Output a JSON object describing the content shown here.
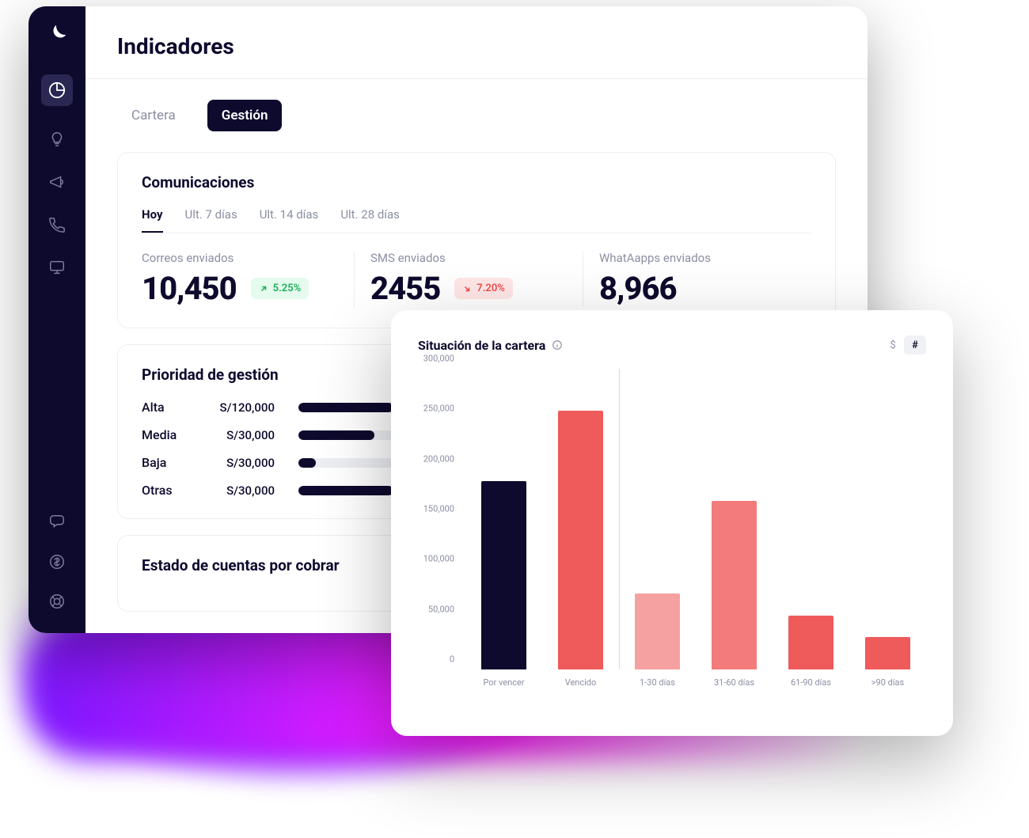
{
  "page": {
    "title": "Indicadores"
  },
  "tabs": {
    "cartera": "Cartera",
    "gestion": "Gestión"
  },
  "comunicaciones": {
    "title": "Comunicaciones",
    "subtabs": {
      "hoy": "Hoy",
      "d7": "Ult. 7 días",
      "d14": "Ult. 14 días",
      "d28": "Ult. 28 días"
    },
    "stats": {
      "correos": {
        "label": "Correos enviados",
        "value": "10,450",
        "delta": "5.25%",
        "direction": "up"
      },
      "sms": {
        "label": "SMS enviados",
        "value": "2455",
        "delta": "7.20%",
        "direction": "down"
      },
      "wa": {
        "label": "WhatAapps enviados",
        "value": "8,966"
      }
    }
  },
  "prioridad": {
    "title": "Prioridad de gestión",
    "rows": [
      {
        "name": "Alta",
        "amount": "S/120,000",
        "pct": 100
      },
      {
        "name": "Media",
        "amount": "S/30,000",
        "pct": 80
      },
      {
        "name": "Baja",
        "amount": "S/30,000",
        "pct": 18
      },
      {
        "name": "Otras",
        "amount": "S/30,000",
        "pct": 100
      }
    ]
  },
  "estado_cuentas": {
    "title": "Estado de cuentas por cobrar"
  },
  "situacion": {
    "title": "Situación de la cartera",
    "toggle": {
      "currency": "$",
      "count": "#"
    }
  },
  "chart_data": {
    "type": "bar",
    "title": "Situación de la cartera",
    "ylabel": "",
    "xlabel": "",
    "ylim": [
      0,
      300000
    ],
    "y_ticks": [
      0,
      50000,
      100000,
      150000,
      200000,
      250000,
      300000
    ],
    "categories": [
      "Por vencer",
      "Vencido",
      "1-30 días",
      "31-60 días",
      "61-90 días",
      ">90 días"
    ],
    "values": [
      188000,
      258000,
      76000,
      168000,
      54000,
      32000
    ],
    "colors": [
      "#0d0a2d",
      "#ef5a5a",
      "#f6a1a1",
      "#f37b7b",
      "#ef5a5a",
      "#ef5a5a"
    ],
    "separator_after_index": 1
  }
}
